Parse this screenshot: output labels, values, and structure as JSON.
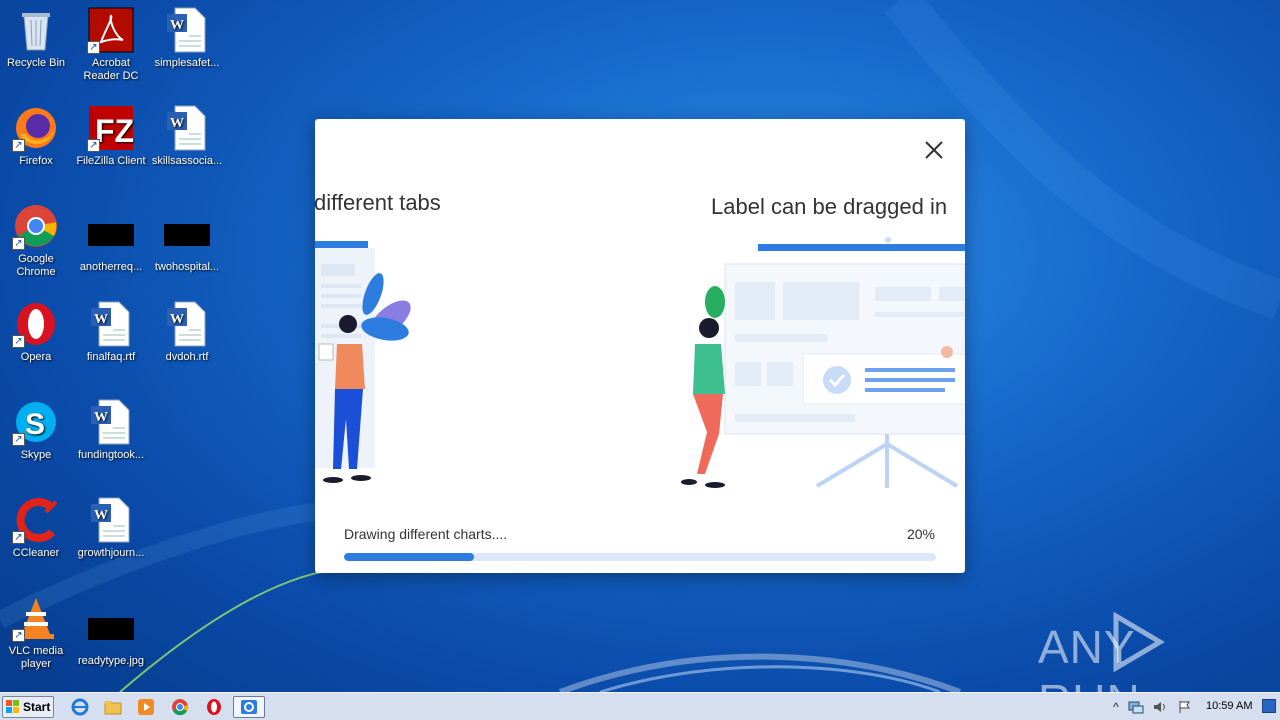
{
  "desktop_icons": [
    {
      "name": "recycle-bin",
      "label": "Recycle Bin"
    },
    {
      "name": "acrobat-reader",
      "label": "Acrobat Reader DC"
    },
    {
      "name": "simplesafety-doc",
      "label": "simplesafet..."
    },
    {
      "name": "firefox",
      "label": "Firefox"
    },
    {
      "name": "filezilla",
      "label": "FileZilla Client"
    },
    {
      "name": "skillsassocia-doc",
      "label": "skillsassocia..."
    },
    {
      "name": "google-chrome",
      "label": "Google Chrome"
    },
    {
      "name": "anotherreq",
      "label": "anotherreq..."
    },
    {
      "name": "twohospital",
      "label": "twohospital..."
    },
    {
      "name": "opera",
      "label": "Opera"
    },
    {
      "name": "finalfaq-doc",
      "label": "finalfaq.rtf"
    },
    {
      "name": "dvdoh-doc",
      "label": "dvdoh.rtf"
    },
    {
      "name": "skype",
      "label": "Skype"
    },
    {
      "name": "fundingtook-doc",
      "label": "fundingtook..."
    },
    {
      "name": "ccleaner",
      "label": "CCleaner"
    },
    {
      "name": "growthjourn-doc",
      "label": "growthjourn..."
    },
    {
      "name": "vlc",
      "label": "VLC media player"
    },
    {
      "name": "readytype",
      "label": "readytype.jpg"
    }
  ],
  "dialog": {
    "slide_left_title": "different tabs",
    "slide_right_title": "Label can be dragged in",
    "status": "Drawing different charts....",
    "progress_label": "20%",
    "progress_value": 0.22
  },
  "watermark": {
    "text": "ANY RUN"
  },
  "taskbar": {
    "start_label": "Start",
    "clock": "10:59 AM",
    "pinned": [
      "internet-explorer",
      "file-explorer",
      "media-player",
      "chrome",
      "opera",
      "active-app"
    ]
  },
  "colors": {
    "accent": "#2d7de0",
    "progress_track": "#dbe8fb",
    "desktop_bg": "#1667c9"
  }
}
